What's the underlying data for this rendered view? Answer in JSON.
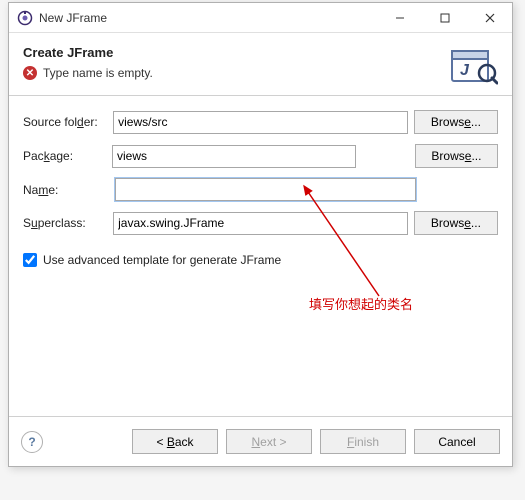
{
  "titlebar": {
    "title": "New JFrame"
  },
  "header": {
    "title": "Create JFrame",
    "error_msg": "Type name is empty."
  },
  "form": {
    "source_label_pre": "Source fol",
    "source_label_mn": "d",
    "source_label_post": "er:",
    "source_value": "views/src",
    "package_label_pre": "Pac",
    "package_label_mn": "k",
    "package_label_post": "age:",
    "package_value": "views",
    "name_label_pre": "Na",
    "name_label_mn": "m",
    "name_label_post": "e:",
    "name_value": "",
    "super_label_pre": "S",
    "super_label_mn": "u",
    "super_label_post": "perclass:",
    "super_value": "javax.swing.JFrame",
    "browse_pre": "Brows",
    "browse_mn": "e",
    "browse_post": "...",
    "checkbox_label": "Use advanced template for generate JFrame",
    "checkbox_checked": true
  },
  "annotation": {
    "text": "填写你想起的类名"
  },
  "footer": {
    "back_pre": "< ",
    "back_mn": "B",
    "back_post": "ack",
    "next_pre": "",
    "next_mn": "N",
    "next_post": "ext >",
    "finish_pre": "",
    "finish_mn": "F",
    "finish_post": "inish",
    "cancel": "Cancel"
  }
}
